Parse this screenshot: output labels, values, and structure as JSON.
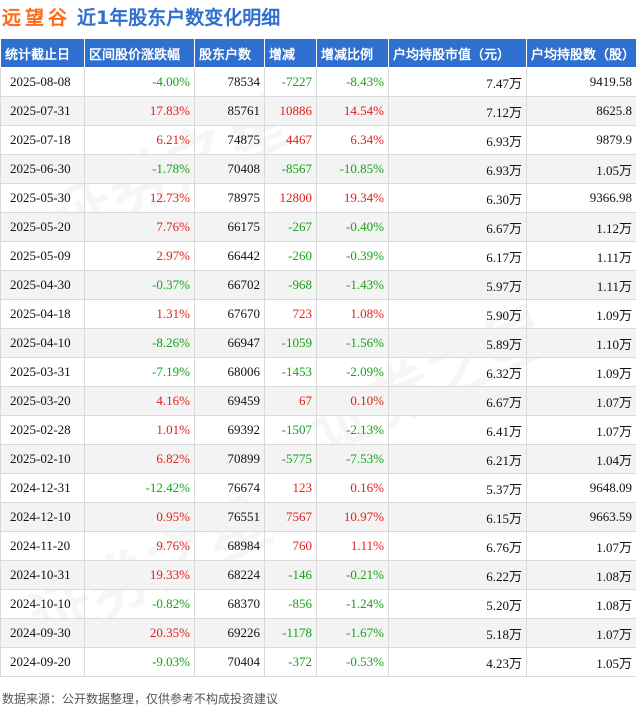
{
  "title": {
    "stock_name": "远望谷",
    "subtitle": "近1年股东户数变化明细"
  },
  "columns": [
    "统计截止日",
    "区间股价涨跌幅",
    "股东户数",
    "增减",
    "增减比例",
    "户均持股市值（元）",
    "户均持股数（股）"
  ],
  "rows": [
    [
      "2025-08-08",
      "-4.00%",
      "78534",
      "-7227",
      "-8.43%",
      "7.47万",
      "9419.58"
    ],
    [
      "2025-07-31",
      "17.83%",
      "85761",
      "10886",
      "14.54%",
      "7.12万",
      "8625.8"
    ],
    [
      "2025-07-18",
      "6.21%",
      "74875",
      "4467",
      "6.34%",
      "6.93万",
      "9879.9"
    ],
    [
      "2025-06-30",
      "-1.78%",
      "70408",
      "-8567",
      "-10.85%",
      "6.93万",
      "1.05万"
    ],
    [
      "2025-05-30",
      "12.73%",
      "78975",
      "12800",
      "19.34%",
      "6.30万",
      "9366.98"
    ],
    [
      "2025-05-20",
      "7.76%",
      "66175",
      "-267",
      "-0.40%",
      "6.67万",
      "1.12万"
    ],
    [
      "2025-05-09",
      "2.97%",
      "66442",
      "-260",
      "-0.39%",
      "6.17万",
      "1.11万"
    ],
    [
      "2025-04-30",
      "-0.37%",
      "66702",
      "-968",
      "-1.43%",
      "5.97万",
      "1.11万"
    ],
    [
      "2025-04-18",
      "1.31%",
      "67670",
      "723",
      "1.08%",
      "5.90万",
      "1.09万"
    ],
    [
      "2025-04-10",
      "-8.26%",
      "66947",
      "-1059",
      "-1.56%",
      "5.89万",
      "1.10万"
    ],
    [
      "2025-03-31",
      "-7.19%",
      "68006",
      "-1453",
      "-2.09%",
      "6.32万",
      "1.09万"
    ],
    [
      "2025-03-20",
      "4.16%",
      "69459",
      "67",
      "0.10%",
      "6.67万",
      "1.07万"
    ],
    [
      "2025-02-28",
      "1.01%",
      "69392",
      "-1507",
      "-2.13%",
      "6.41万",
      "1.07万"
    ],
    [
      "2025-02-10",
      "6.82%",
      "70899",
      "-5775",
      "-7.53%",
      "6.21万",
      "1.04万"
    ],
    [
      "2024-12-31",
      "-12.42%",
      "76674",
      "123",
      "0.16%",
      "5.37万",
      "9648.09"
    ],
    [
      "2024-12-10",
      "0.95%",
      "76551",
      "7567",
      "10.97%",
      "6.15万",
      "9663.59"
    ],
    [
      "2024-11-20",
      "9.76%",
      "68984",
      "760",
      "1.11%",
      "6.76万",
      "1.07万"
    ],
    [
      "2024-10-31",
      "19.33%",
      "68224",
      "-146",
      "-0.21%",
      "6.22万",
      "1.08万"
    ],
    [
      "2024-10-10",
      "-0.82%",
      "68370",
      "-856",
      "-1.24%",
      "5.20万",
      "1.08万"
    ],
    [
      "2024-09-30",
      "20.35%",
      "69226",
      "-1178",
      "-1.67%",
      "5.18万",
      "1.07万"
    ],
    [
      "2024-09-20",
      "-9.03%",
      "70404",
      "-372",
      "-0.53%",
      "4.23万",
      "1.05万"
    ]
  ],
  "footer": {
    "source": "数据来源：公开数据整理，仅供参考不构成投资建议"
  },
  "watermark": "证券之星",
  "colors": {
    "header_bg": "#2f6fcf",
    "up": "#e0211b",
    "down": "#16a316",
    "stock_name": "#ff6a1a"
  }
}
